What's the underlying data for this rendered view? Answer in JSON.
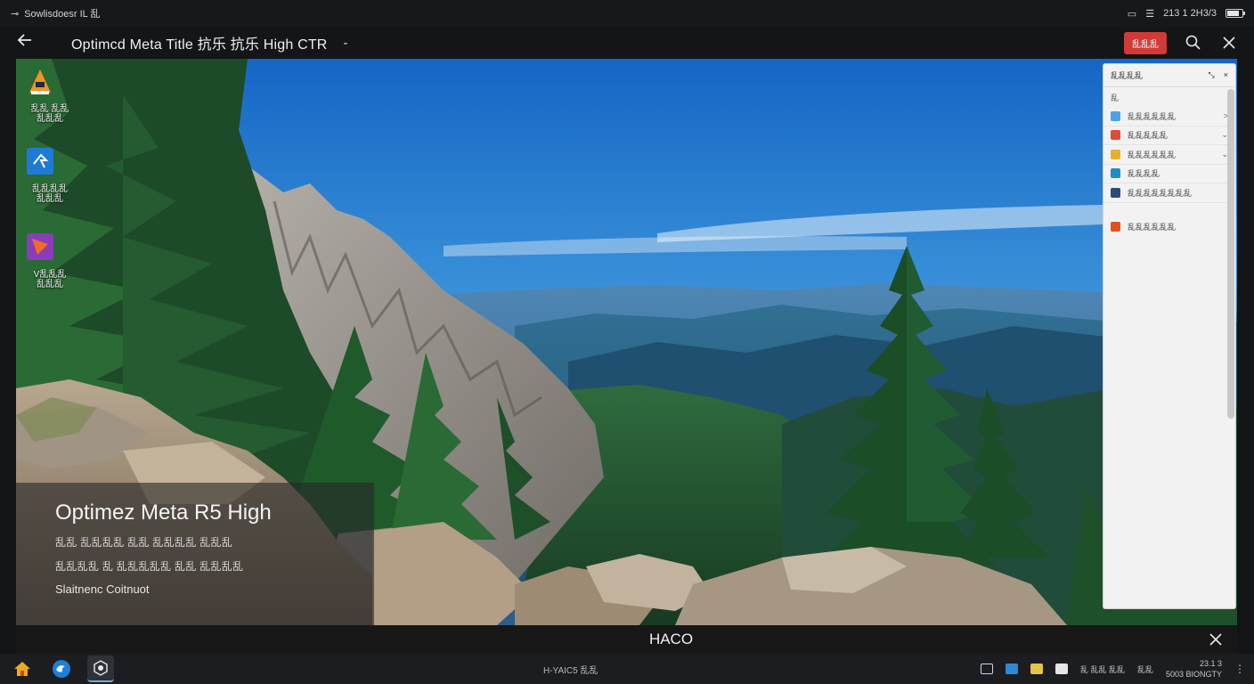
{
  "status_bar": {
    "left_text": "Sowlisdoesr IL 乱",
    "right_time": "213 1 2H3/3",
    "battery_level": 0.8
  },
  "title_bar": {
    "title": "Optimcd Meta Title 抗乐  抗乐  High CTR",
    "dash": "-",
    "red_button": "乱乱乱"
  },
  "desktop_icons": [
    {
      "label": "乱乱 乱乱\n乱乱乱",
      "icon": "vlc-icon",
      "color": "#f08a1c"
    },
    {
      "label": "乱乱乱乱\n乱乱乱",
      "icon": "app-blue-icon",
      "color": "#1f7ad6"
    },
    {
      "label": "V乱乱乱\n乱乱乱",
      "icon": "app-purple-icon",
      "color": "#8a3db8"
    }
  ],
  "caption": {
    "heading": "Optimez Meta R5  High",
    "line1": "乱乱 乱乱乱乱 乱乱 乱乱乱乱 乱乱乱",
    "line2": "乱乱乱乱 乱 乱乱乱乱乱 乱乱 乱乱乱乱",
    "line3": "Slaitnenc Coitnuot"
  },
  "side_panel": {
    "header": "乱乱乱乱",
    "sub": "乱",
    "items": [
      {
        "label": "乱乱乱乱乱乱",
        "color": "#4aa3e6",
        "chev": ">"
      },
      {
        "label": "乱乱乱乱乱",
        "color": "#e04a3a",
        "chev": "⌄"
      },
      {
        "label": "乱乱乱乱乱乱",
        "color": "#e6b22e",
        "chev": "⌄"
      },
      {
        "label": "乱乱乱乱",
        "color": "#1e8fbf",
        "chev": ""
      },
      {
        "label": "乱乱乱乱乱乱乱乱",
        "color": "#2f4a7a",
        "chev": ""
      },
      {
        "label": "乱乱乱乱乱乱",
        "color": "#e0521e",
        "chev": ""
      }
    ]
  },
  "bottom_strip": {
    "text": "HACO"
  },
  "taskbar": {
    "center_text": "H-YAIC5  乱乱",
    "tray_text": "乱 乱乱 乱乱",
    "tray_label": "乱乱",
    "clock_top": "23.1 3",
    "clock_bottom": "5003 BIONGTY"
  }
}
